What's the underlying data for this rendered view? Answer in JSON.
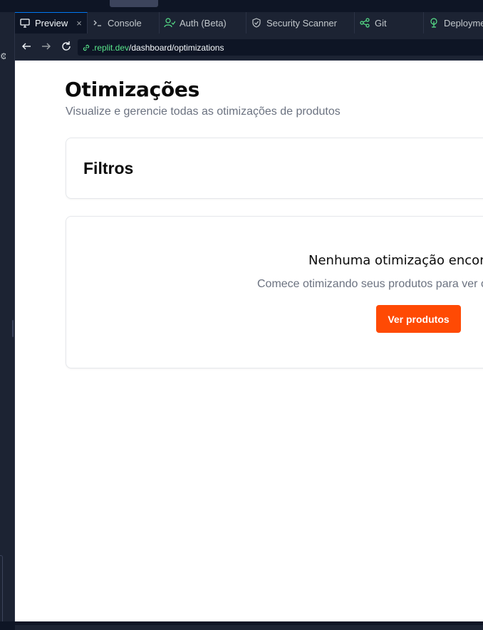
{
  "tabs": [
    {
      "label": "Preview",
      "icon": "monitor-icon",
      "active": true,
      "closable": true
    },
    {
      "label": "Console",
      "icon": "terminal-icon",
      "active": false
    },
    {
      "label": "Auth (Beta)",
      "icon": "user-check-icon",
      "active": false
    },
    {
      "label": "Security Scanner",
      "icon": "shield-icon",
      "active": false
    },
    {
      "label": "Git",
      "icon": "git-branch-icon",
      "active": false
    },
    {
      "label": "Deployments",
      "icon": "deploy-icon",
      "active": false
    }
  ],
  "urlbar": {
    "host": ".replit.dev",
    "path": "/dashboard/optimizations"
  },
  "page": {
    "title": "Otimizações",
    "subtitle": "Visualize e gerencie todas as otimizações de produtos",
    "filters_title": "Filtros",
    "empty_title": "Nenhuma otimização encontrada",
    "empty_description": "Comece otimizando seus produtos para ver os resultados aqui",
    "empty_button": "Ver produtos"
  },
  "colors": {
    "ide_background": "#0e1525",
    "ide_panel": "#1c2333",
    "accent_blue": "#0079f2",
    "url_host_green": "#58e38a",
    "primary_button": "#ff4a04",
    "muted_text": "#6b7280"
  }
}
